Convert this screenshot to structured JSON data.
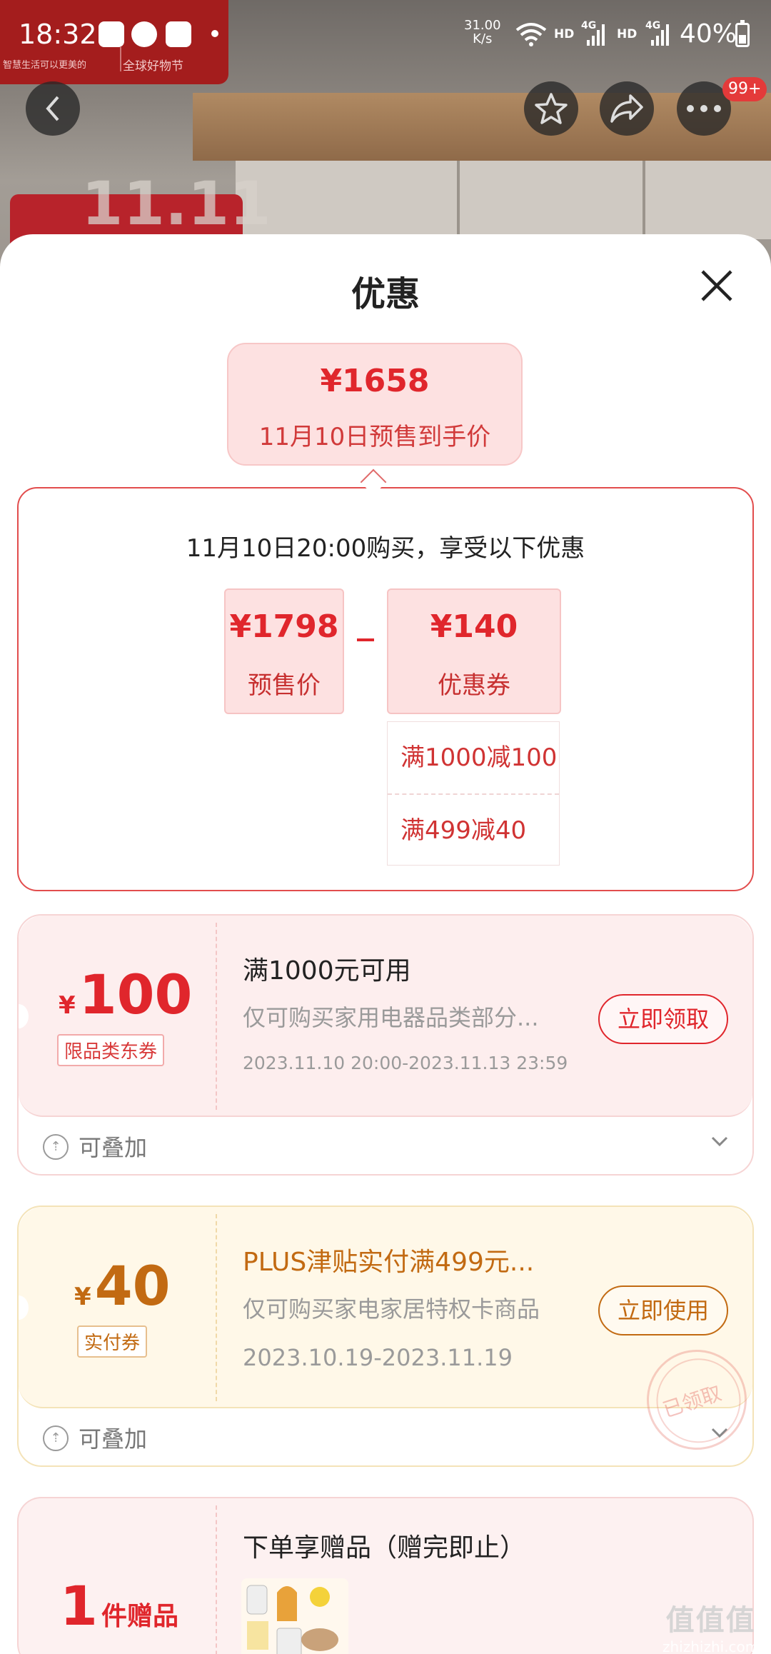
{
  "status_bar": {
    "time": "18:32",
    "net_speed_value": "31.00",
    "net_speed_unit": "K/s",
    "hd1": "HD",
    "hd2": "HD",
    "sig1": "4G",
    "sig2": "4G",
    "battery": "40%"
  },
  "background": {
    "banner_slogan": "智慧生活可以更美的",
    "banner_event": "全球好物节",
    "badge_text": "11.11",
    "notification_count": "99+"
  },
  "sheet": {
    "title": "优惠",
    "final_price": {
      "amount": "¥1658",
      "label": "11月10日预售到手价"
    },
    "detail": {
      "heading": "11月10日20:00购买，享受以下优惠",
      "presale": {
        "value": "¥1798",
        "label": "预售价"
      },
      "coupon": {
        "value": "¥140",
        "label": "优惠券"
      },
      "coupon_items": [
        "满1000减100",
        "满499减40"
      ]
    }
  },
  "coupons": [
    {
      "currency": "¥",
      "amount": "100",
      "tag": "限品类东券",
      "title": "满1000元可用",
      "desc": "仅可购买家用电器品类部分...",
      "period": "2023.11.10 20:00-2023.11.13 23:59",
      "action": "立即领取",
      "stack_label": "可叠加"
    },
    {
      "currency": "¥",
      "amount": "40",
      "tag": "实付券",
      "title": "PLUS津贴实付满499元...",
      "desc": "仅可购买家电家居特权卡商品",
      "period": "2023.10.19-2023.11.19",
      "action": "立即使用",
      "stack_label": "可叠加",
      "stamp": "已领取"
    }
  ],
  "gift": {
    "count": "1",
    "unit": "件赠品",
    "title": "下单享赠品（赠完即止）"
  },
  "watermark": {
    "main": "值值值",
    "sub": "zhizhizhi.com"
  },
  "colors": {
    "accent_red": "#e0262c",
    "gold": "#c26a12"
  }
}
